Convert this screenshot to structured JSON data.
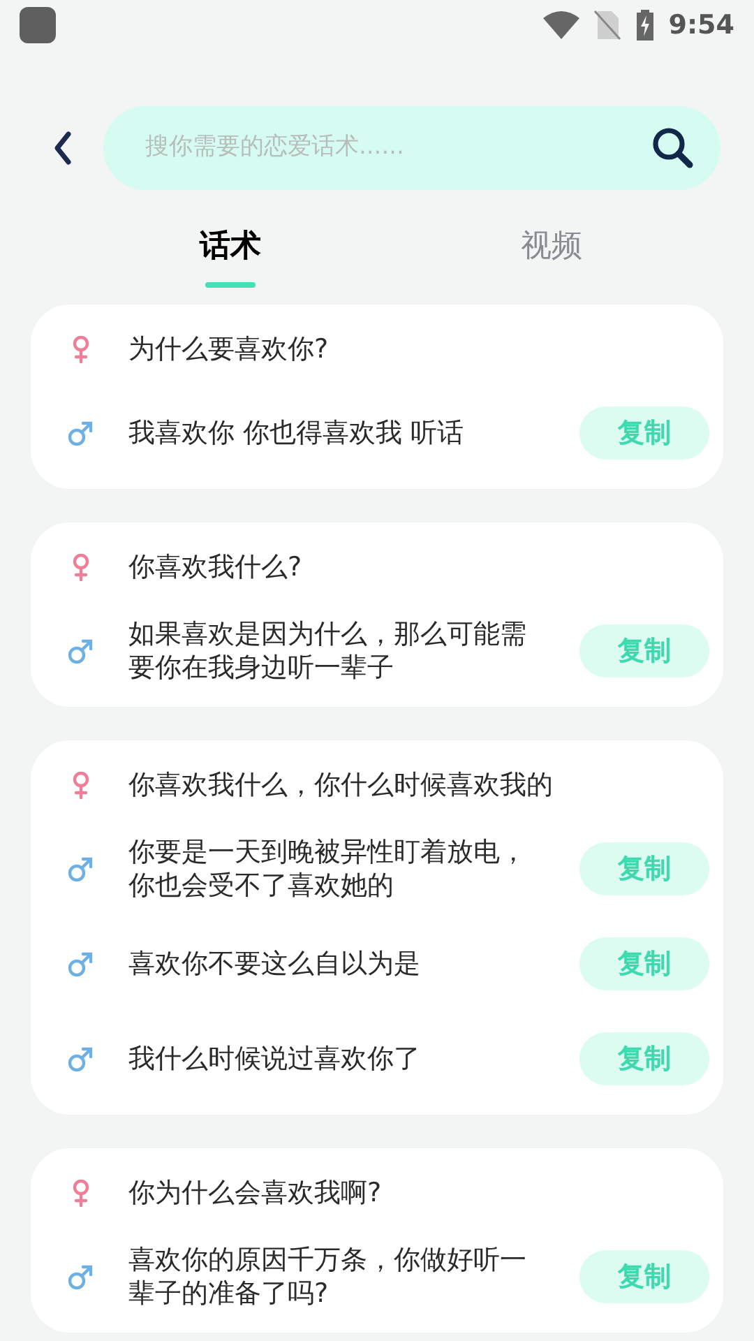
{
  "status_bar": {
    "time": "9:54"
  },
  "search": {
    "placeholder": "搜你需要的恋爱话术......"
  },
  "tabs": [
    {
      "label": "话术",
      "selected": true
    },
    {
      "label": "视频",
      "selected": false
    }
  ],
  "cards": [
    {
      "question": {
        "kind": "female",
        "text": "为什么要喜欢你?"
      },
      "answers": [
        {
          "kind": "male",
          "text": "我喜欢你 你也得喜欢我 听话",
          "button": "复制"
        }
      ]
    },
    {
      "question": {
        "kind": "female",
        "text": "你喜欢我什么?"
      },
      "answers": [
        {
          "kind": "male",
          "text": "如果喜欢是因为什么，那么可能需要你在我身边听一辈子",
          "button": "复制"
        }
      ]
    },
    {
      "question": {
        "kind": "female",
        "text": "你喜欢我什么，你什么时候喜欢我的"
      },
      "answers": [
        {
          "kind": "male",
          "text": "你要是一天到晚被异性盯着放电，你也会受不了喜欢她的",
          "button": "复制"
        },
        {
          "kind": "male",
          "text": "喜欢你不要这么自以为是",
          "button": "复制"
        },
        {
          "kind": "male",
          "text": "我什么时候说过喜欢你了",
          "button": "复制"
        }
      ]
    },
    {
      "question": {
        "kind": "female",
        "text": "你为什么会喜欢我啊?"
      },
      "answers": [
        {
          "kind": "male",
          "text": "喜欢你的原因千万条，你做好听一辈子的准备了吗?",
          "button": "复制"
        }
      ]
    }
  ]
}
